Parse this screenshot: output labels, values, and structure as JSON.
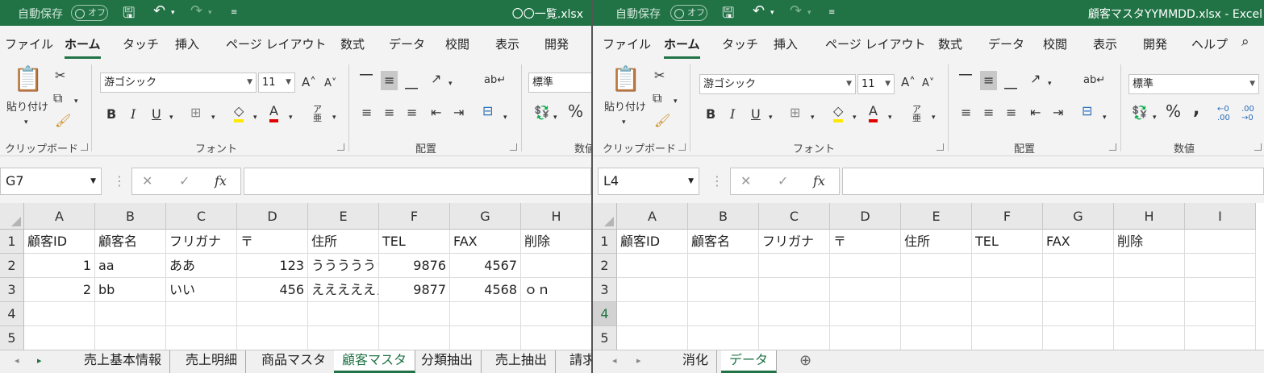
{
  "w1": {
    "autosave_label": "自動保存",
    "autosave_state": "オフ",
    "filename": "〇〇一覧.xlsx",
    "tabs": [
      "ファイル",
      "ホーム",
      "タッチ",
      "挿入",
      "ページ レイアウト",
      "数式",
      "データ",
      "校閲",
      "表示",
      "開発"
    ],
    "paste_label": "貼り付け",
    "font_name": "游ゴシック",
    "font_size": "11",
    "number_format": "標準",
    "groups": [
      "クリップボード",
      "フォント",
      "配置",
      "数値"
    ],
    "name_box": "G7",
    "columns": [
      "A",
      "B",
      "C",
      "D",
      "E",
      "F",
      "G",
      "H"
    ],
    "rows": [
      "1",
      "2",
      "3",
      "4",
      "5"
    ],
    "cells": [
      [
        "顧客ID",
        "顧客名",
        "フリガナ",
        "〒",
        "住所",
        "TEL",
        "FAX",
        "削除"
      ],
      [
        "1",
        "aa",
        "ああ",
        "123",
        "うううううう",
        "9876",
        "4567",
        ""
      ],
      [
        "2",
        "bb",
        "いい",
        "456",
        "ええええええ",
        "9877",
        "4568",
        "ｏｎ"
      ]
    ],
    "sheets": [
      "売上基本情報",
      "売上明細",
      "商品マスタ",
      "顧客マスタ",
      "分類抽出",
      "売上抽出",
      "請求"
    ],
    "active_sheet": "顧客マスタ"
  },
  "w2": {
    "autosave_label": "自動保存",
    "autosave_state": "オフ",
    "filename": "顧客マスタYYMMDD.xlsx  -  Excel",
    "tabs": [
      "ファイル",
      "ホーム",
      "タッチ",
      "挿入",
      "ページ レイアウト",
      "数式",
      "データ",
      "校閲",
      "表示",
      "開発",
      "ヘルプ"
    ],
    "paste_label": "貼り付け",
    "font_name": "游ゴシック",
    "font_size": "11",
    "number_format": "標準",
    "groups": [
      "クリップボード",
      "フォント",
      "配置",
      "数値"
    ],
    "name_box": "L4",
    "columns": [
      "A",
      "B",
      "C",
      "D",
      "E",
      "F",
      "G",
      "H",
      "I"
    ],
    "rows": [
      "1",
      "2",
      "3",
      "4",
      "5"
    ],
    "cells": [
      [
        "顧客ID",
        "顧客名",
        "フリガナ",
        "〒",
        "住所",
        "TEL",
        "FAX",
        "削除"
      ]
    ],
    "sheets": [
      "消化",
      "データ"
    ],
    "active_sheet": "データ"
  },
  "icons": {
    "fx": "fx",
    "cancel": "✕",
    "enter": "✓",
    "bold": "B",
    "italic": "I",
    "underline": "U",
    "percent": "%",
    "add_sheet": "⊕"
  },
  "colors": {
    "excel_green": "#217346",
    "font_red": "#e00000",
    "highlight_yellow": "#ffe800"
  }
}
